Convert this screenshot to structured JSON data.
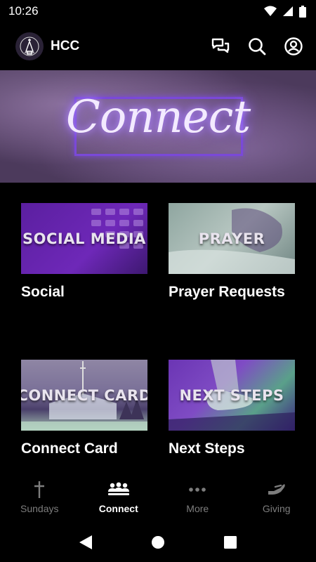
{
  "status": {
    "time": "10:26"
  },
  "app": {
    "title": "HCC"
  },
  "hero": {
    "text": "Connect"
  },
  "cards": [
    {
      "thumb_text": "SOCIAL MEDIA",
      "label": "Social"
    },
    {
      "thumb_text": "PRAYER",
      "label": "Prayer Requests"
    },
    {
      "thumb_text": "CONNECT CARD",
      "label": "Connect Card"
    },
    {
      "thumb_text": "NEXT STEPS",
      "label": "Next Steps"
    }
  ],
  "nav": [
    {
      "label": "Sundays",
      "icon": "cross-icon",
      "active": false
    },
    {
      "label": "Connect",
      "icon": "people-icon",
      "active": true
    },
    {
      "label": "More",
      "icon": "more-dots-icon",
      "active": false
    },
    {
      "label": "Giving",
      "icon": "giving-hand-icon",
      "active": false
    }
  ],
  "colors": {
    "accent": "#7a49d8",
    "inactive": "#7d7d7d",
    "background": "#000000"
  }
}
